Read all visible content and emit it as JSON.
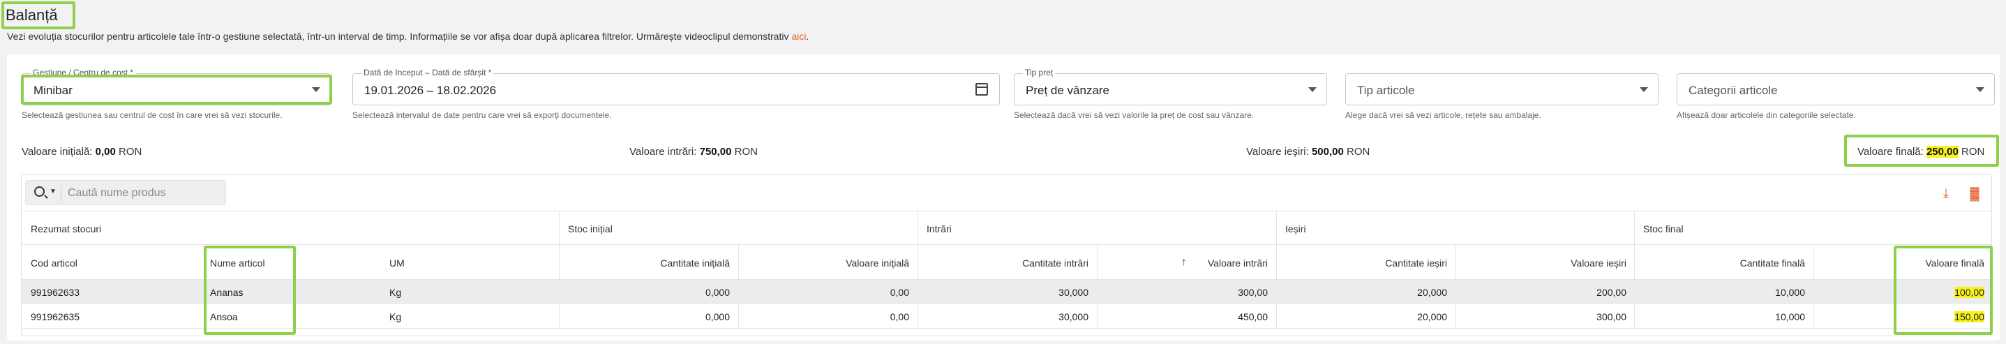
{
  "page": {
    "title": "Balanță",
    "subtitle": "Vezi evoluția stocurilor pentru articolele tale într-o gestiune selectată, într-un interval de timp. Informațiile se vor afișa doar după aplicarea filtrelor. Urmărește videoclipul demonstrativ",
    "subtitle_link": "aici",
    "subtitle_end": "."
  },
  "filters": {
    "gestiune": {
      "label": "Gestiune / Centru de cost *",
      "value": "Minibar",
      "helper": "Selectează gestiunea sau centrul de cost în care vrei să vezi stocurile."
    },
    "date": {
      "label": "Dată de început – Dată de sfârșit *",
      "value": "19.01.2026 – 18.02.2026",
      "helper": "Selectează intervalul de date pentru care vrei să exporți documentele."
    },
    "tip_pret": {
      "label": "Tip preț",
      "value": "Preț de vânzare",
      "helper": "Selectează dacă vrei să vezi valorile la preț de cost sau vânzare."
    },
    "tip_articole": {
      "placeholder": "Tip articole",
      "helper": "Alege dacă vrei să vezi articole, rețete sau ambalaje."
    },
    "categorii": {
      "placeholder": "Categorii articole",
      "helper": "Afișează doar articolele din categoriile selectate."
    }
  },
  "summary": {
    "initial_label": "Valoare inițială:",
    "initial_value": "0,00",
    "initial_unit": "RON",
    "intrari_label": "Valoare intrări:",
    "intrari_value": "750,00",
    "intrari_unit": "RON",
    "iesiri_label": "Valoare ieșiri:",
    "iesiri_value": "500,00",
    "iesiri_unit": "RON",
    "final_label": "Valoare finală:",
    "final_value": "250,00",
    "final_unit": "RON"
  },
  "search": {
    "placeholder": "Caută nume produs"
  },
  "table": {
    "groups": [
      "Rezumat stocuri",
      "Stoc inițial",
      "Intrări",
      "Ieșiri",
      "Stoc final"
    ],
    "columns": [
      "Cod articol",
      "Nume articol",
      "UM",
      "Cantitate inițială",
      "Valoare inițială",
      "Cantitate intrări",
      "Valoare intrări",
      "Cantitate ieșiri",
      "Valoare ieșiri",
      "Cantitate finală",
      "Valoare finală"
    ],
    "rows": [
      [
        "991962633",
        "Ananas",
        "Kg",
        "0,000",
        "0,00",
        "30,000",
        "300,00",
        "20,000",
        "200,00",
        "10,000",
        "100,00"
      ],
      [
        "991962635",
        "Ansoa",
        "Kg",
        "0,000",
        "0,00",
        "30,000",
        "450,00",
        "20,000",
        "300,00",
        "10,000",
        "150,00"
      ]
    ]
  },
  "icons": {
    "sort": "arrow-up-icon",
    "download": "download-icon",
    "columns": "columns-icon"
  },
  "colors": {
    "accent": "#e35d2b",
    "highlight_border": "#8fcf4a",
    "highlight_fill": "#f7f31a"
  }
}
